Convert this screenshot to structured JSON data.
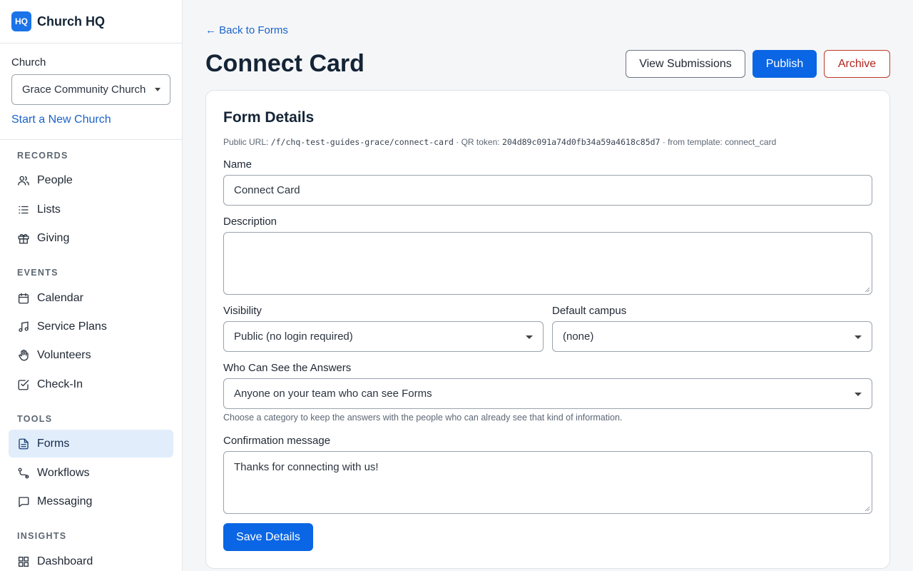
{
  "app": {
    "logo_text": "HQ",
    "name": "Church HQ"
  },
  "church": {
    "label": "Church",
    "selected": "Grace Community Church",
    "new_church_link": "Start a New Church"
  },
  "nav": {
    "records_title": "RECORDS",
    "events_title": "EVENTS",
    "tools_title": "TOOLS",
    "insights_title": "INSIGHTS",
    "people": "People",
    "lists": "Lists",
    "giving": "Giving",
    "calendar": "Calendar",
    "service_plans": "Service Plans",
    "volunteers": "Volunteers",
    "check_in": "Check-In",
    "forms": "Forms",
    "workflows": "Workflows",
    "messaging": "Messaging",
    "dashboard": "Dashboard",
    "active": "Forms"
  },
  "header": {
    "back_link": "← Back to Forms",
    "title": "Connect Card",
    "view_submissions": "View Submissions",
    "publish": "Publish",
    "archive": "Archive"
  },
  "form_details": {
    "title": "Form Details",
    "public_url_label": "Public URL:",
    "public_url": "/f/chq-test-guides-grace/connect-card",
    "qr_label": "· QR token:",
    "qr_token": "204d89c091a74d0fb34a59a4618c85d7",
    "template_text": "· from template: connect_card",
    "name_label": "Name",
    "name_value": "Connect Card",
    "description_label": "Description",
    "description_value": "",
    "visibility_label": "Visibility",
    "visibility_value": "Public (no login required)",
    "campus_label": "Default campus",
    "campus_value": "(none)",
    "answers_label": "Who Can See the Answers",
    "answers_value": "Anyone on your team who can see Forms",
    "answers_hint": "Choose a category to keep the answers with the people who can already see that kind of information.",
    "confirmation_label": "Confirmation message",
    "confirmation_value": "Thanks for connecting with us!",
    "save_button": "Save Details"
  },
  "colors": {
    "primary": "#0a66e4",
    "link": "#1a63c9",
    "danger": "#b3261e",
    "active_nav_bg": "#e1edfb"
  }
}
